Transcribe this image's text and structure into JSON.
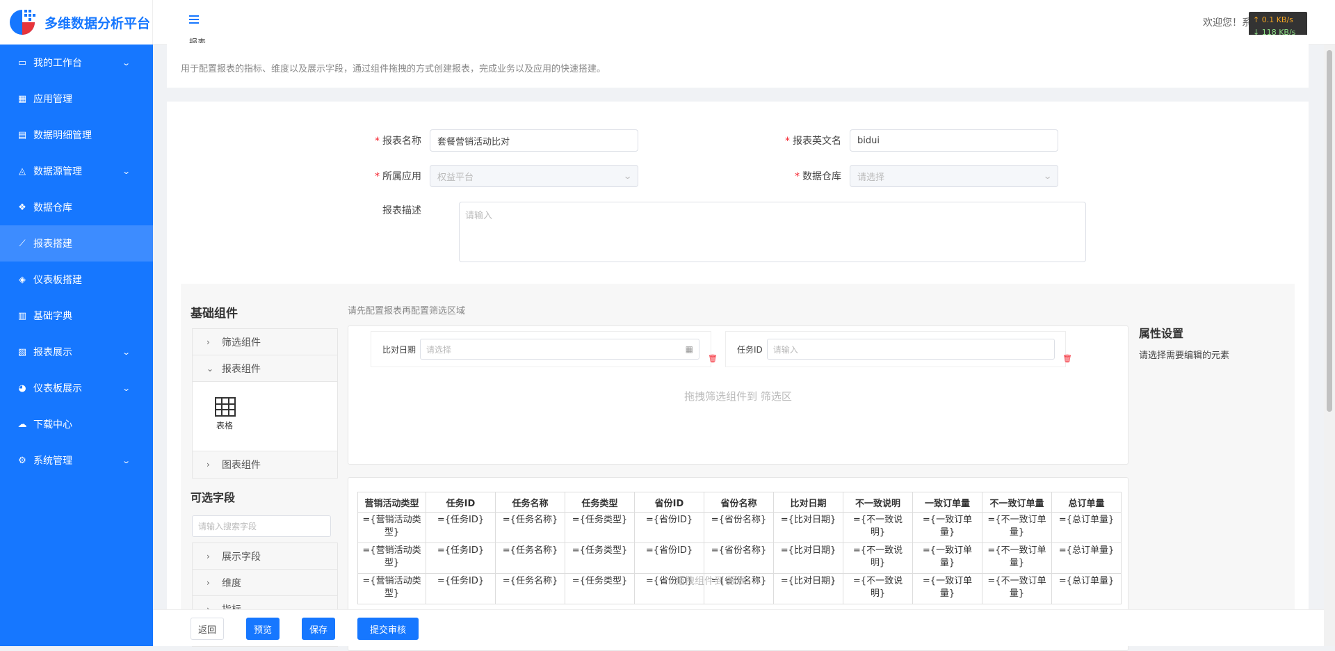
{
  "app": {
    "title": "多维数据分析平台"
  },
  "sidebar": {
    "items": [
      {
        "label": "我的工作台",
        "icon": "monitor-icon",
        "expandable": true
      },
      {
        "label": "应用管理",
        "icon": "apps-icon",
        "expandable": false
      },
      {
        "label": "数据明细管理",
        "icon": "document-icon",
        "expandable": false
      },
      {
        "label": "数据源管理",
        "icon": "datasource-icon",
        "expandable": true
      },
      {
        "label": "数据仓库",
        "icon": "warehouse-icon",
        "expandable": false
      },
      {
        "label": "报表搭建",
        "icon": "line-chart-icon",
        "expandable": false,
        "active": true
      },
      {
        "label": "仪表板搭建",
        "icon": "layers-icon",
        "expandable": false
      },
      {
        "label": "基础字典",
        "icon": "dictionary-icon",
        "expandable": false
      },
      {
        "label": "报表展示",
        "icon": "bar-chart-icon",
        "expandable": true
      },
      {
        "label": "仪表板展示",
        "icon": "pie-chart-icon",
        "expandable": true
      },
      {
        "label": "下载中心",
        "icon": "cloud-download-icon",
        "expandable": false
      },
      {
        "label": "系统管理",
        "icon": "settings-icon",
        "expandable": true
      }
    ]
  },
  "header": {
    "welcome": "欢迎您！系",
    "net_up": "↑ 0.1 KB/s",
    "net_down": "↓ 118 KB/s"
  },
  "page": {
    "title_cut": "报表",
    "description": "用于配置报表的指标、维度以及展示字段，通过组件拖拽的方式创建报表，完成业务以及应用的快速搭建。"
  },
  "form": {
    "report_name_label": "报表名称",
    "report_name_value": "套餐营销活动比对",
    "report_en_label": "报表英文名",
    "report_en_value": "bidui",
    "app_label": "所属应用",
    "app_value": "权益平台",
    "warehouse_label": "数据仓库",
    "warehouse_placeholder": "请选择",
    "desc_label": "报表描述",
    "desc_placeholder": "请输入"
  },
  "designer": {
    "basic_title": "基础组件",
    "filter_group": "筛选组件",
    "report_group": "报表组件",
    "table_comp": "表格",
    "chart_group": "图表组件",
    "fields_title": "可选字段",
    "field_search_placeholder": "请输入搜索字段",
    "display_fields": "展示字段",
    "dimension": "维度",
    "metric": "指标",
    "filter_hint": "请先配置报表再配置筛选区域",
    "filter_date_label": "比对日期",
    "filter_date_placeholder": "请选择",
    "filter_task_label": "任务ID",
    "filter_task_placeholder": "请输入",
    "drop_filter_hint": "拖拽筛选组件到 筛选区",
    "drop_table_hint": "拖拽组件到 报表",
    "prop_title": "属性设置",
    "prop_desc": "请选择需要编辑的元素"
  },
  "report_table": {
    "headers": [
      "营销活动类型",
      "任务ID",
      "任务名称",
      "任务类型",
      "省份ID",
      "省份名称",
      "比对日期",
      "不一致说明",
      "一致订单量",
      "不一致订单量",
      "总订单量"
    ],
    "row": [
      "={营销活动类型}",
      "={任务ID}",
      "={任务名称}",
      "={任务类型}",
      "={省份ID}",
      "={省份名称}",
      "={比对日期}",
      "={不一致说明}",
      "={一致订单量}",
      "={不一致订单量}",
      "={总订单量}"
    ]
  },
  "footer": {
    "back": "返回",
    "preview": "预览",
    "save": "保存",
    "submit": "提交审核"
  },
  "colors": {
    "primary": "#1677ff",
    "required": "#f5222d"
  }
}
